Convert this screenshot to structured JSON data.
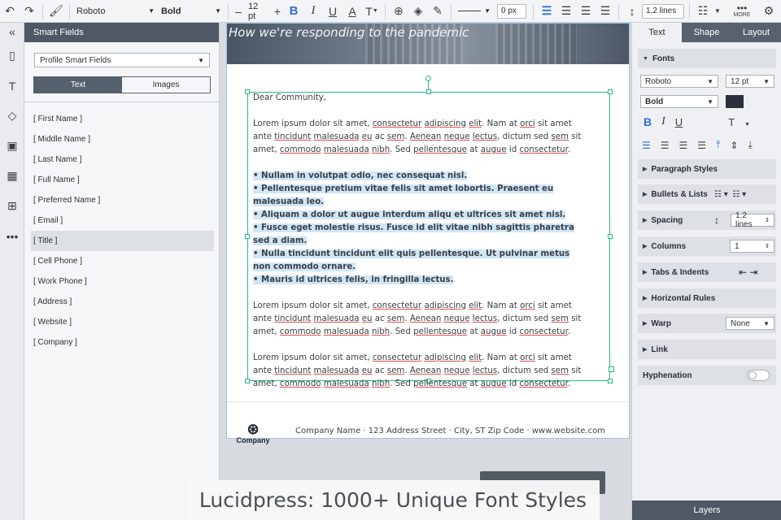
{
  "toolbar": {
    "font_family": "Roboto",
    "font_weight": "Bold",
    "font_size": "12 pt",
    "decrease": "–",
    "increase": "+",
    "bold": "B",
    "italic": "I",
    "underline": "U",
    "text_color": "A",
    "text_type": "T",
    "stroke_width": "0 px",
    "line_spacing": "1.2 lines",
    "more": "MORE"
  },
  "smart_fields": {
    "title": "Smart Fields",
    "dropdown": "Profile Smart Fields",
    "tabs": [
      "Text",
      "Images"
    ],
    "items": [
      "[ First Name ]",
      "[ Middle Name ]",
      "[ Last Name ]",
      "[ Full Name ]",
      "[ Preferred Name ]",
      "[ Email ]",
      "[ Title ]",
      "[ Cell Phone ]",
      "[ Work Phone ]",
      "[ Address ]",
      "[ Website ]",
      "[ Company ]"
    ]
  },
  "document": {
    "hero_title": "How we're responding to the pandemic",
    "greeting": "Dear Community,",
    "bullets": [
      "• Nullam in volutpat odio, nec consequat nisl.",
      "• Pellentesque pretium vitae felis sit amet lobortis. Praesent eu malesuada leo.",
      "• Aliquam a dolor ut augue interdum aliqu et ultrices sit amet nisl.",
      "• Fusce eget molestie risus. Fusce id elit vitae nibh sagittis pharetra sed a diam.",
      "• Nulla tincidunt tincidunt elit quis pellentesque. Ut pulvinar metus non commodo ornare.",
      "• Mauris id ultrices felis, in fringilla lectus."
    ],
    "logo_text": "Company",
    "footer_address": "Company Name · 123 Address Street · City, ST Zip Code · www.website.com"
  },
  "right_panel": {
    "tabs": [
      "Text",
      "Shape",
      "Layout"
    ],
    "fonts_label": "Fonts",
    "font_family": "Roboto",
    "font_size": "12 pt",
    "font_weight": "Bold",
    "bold": "B",
    "italic": "I",
    "underline": "U",
    "text_type": "T",
    "paragraph_styles": "Paragraph Styles",
    "bullets_lists": "Bullets & Lists",
    "spacing": "Spacing",
    "spacing_value": "1.2 lines",
    "columns": "Columns",
    "columns_value": "1",
    "tabs_indents": "Tabs & Indents",
    "horizontal_rules": "Horizontal Rules",
    "warp": "Warp",
    "warp_value": "None",
    "link": "Link",
    "hyphenation": "Hyphenation",
    "layers": "Layers"
  },
  "caption": "Lucidpress: 1000+ Unique Font Styles",
  "colors": {
    "selection": "#2bb58c",
    "highlight": "#cfe6f7",
    "accent": "#2f6fd6",
    "dark_header": "#4f5864"
  }
}
